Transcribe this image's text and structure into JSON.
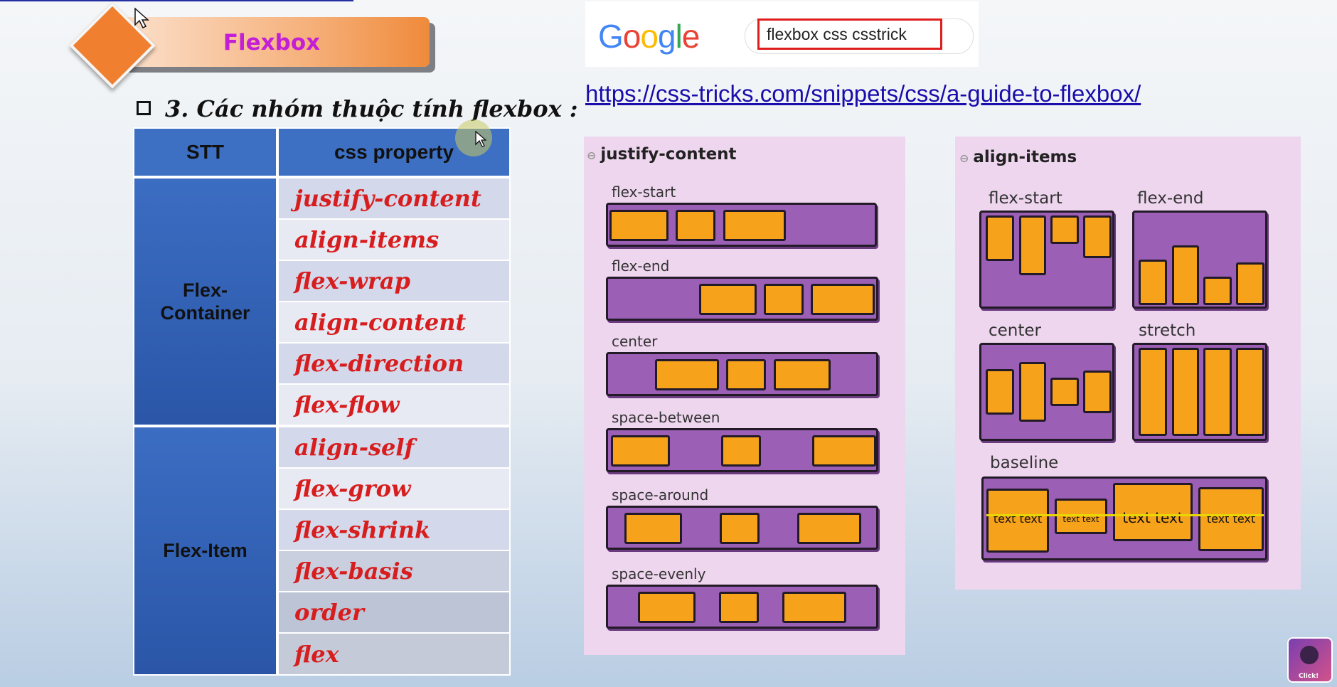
{
  "slide": {
    "banner_title": "Flexbox",
    "section_heading": "3. Các nhóm thuộc tính flexbox :"
  },
  "table": {
    "headers": [
      "STT",
      "css property"
    ],
    "groups": [
      {
        "name": "Flex-\nContainer",
        "rows": [
          "justify-content",
          "align-items",
          "flex-wrap",
          "align-content",
          "flex-direction",
          "flex-flow"
        ]
      },
      {
        "name": "Flex-Item",
        "rows": [
          "align-self",
          "flex-grow",
          "flex-shrink",
          "flex-basis",
          "order",
          "flex"
        ]
      }
    ]
  },
  "google": {
    "logo": "Google",
    "query": "flexbox css csstrick"
  },
  "link": "https://css-tricks.com/snippets/css/a-guide-to-flexbox/",
  "justify_panel": {
    "title": "justify-content",
    "variants": [
      "flex-start",
      "flex-end",
      "center",
      "space-between",
      "space-around",
      "space-evenly"
    ]
  },
  "align_panel": {
    "title": "align-items",
    "variants": [
      "flex-start",
      "flex-end",
      "center",
      "stretch",
      "baseline"
    ],
    "baseline_texts": [
      "text text",
      "text text",
      "text text",
      "text text"
    ]
  },
  "channel": {
    "avatar_caption": "Click!"
  },
  "colors": {
    "header_blue": "#3d6fc2",
    "property_red": "#d71d1d",
    "banner_text": "#c31fd6",
    "flex_container": "#9b5fb5",
    "flex_item": "#f7a21b",
    "panel_bg": "#efd6ef"
  }
}
